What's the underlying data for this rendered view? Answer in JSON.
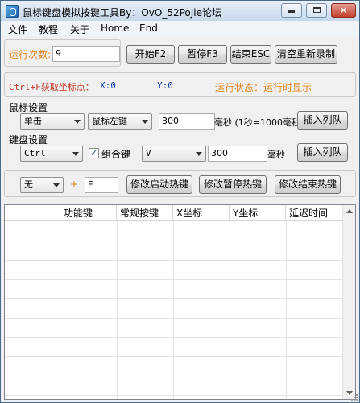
{
  "window": {
    "title": "鼠标键盘模拟按键工具By：OvO_52PoJie论坛",
    "controls": {
      "minimize": "",
      "maximize": "",
      "close": "×"
    }
  },
  "menu": {
    "items": [
      "文件",
      "教程",
      "关于",
      "Home",
      "End"
    ]
  },
  "run": {
    "count_label": "运行次数:",
    "count_value": "9",
    "start_button": "开始F2",
    "pause_button": "暂停F3",
    "end_button": "结束ESC",
    "clear_button": "清空重新录制"
  },
  "coords": {
    "hint": "Ctrl+F获取坐标点：",
    "x_label": "X:0",
    "y_label": "Y:0",
    "status": "运行状态：运行时显示"
  },
  "mouse": {
    "group_label": "鼠标设置",
    "action": "单击",
    "button": "鼠标左键",
    "delay_value": "300",
    "delay_unit": "毫秒 (1秒=1000毫秒)",
    "insert_button": "插入列队"
  },
  "keyboard": {
    "group_label": "键盘设置",
    "modifier": "Ctrl",
    "combo_checked": true,
    "combo_label": "组合键",
    "key": "V",
    "delay_value": "300",
    "delay_unit": "毫秒",
    "insert_button": "插入列队"
  },
  "hotkeys": {
    "modifier": "无",
    "plus": "+",
    "key_value": "E",
    "start_button": "修改启动热键",
    "pause_button": "修改暂停热键",
    "end_button": "修改结束热键"
  },
  "table": {
    "columns": [
      "功能键",
      "常规按键",
      "X坐标",
      "Y坐标",
      "延迟时间"
    ],
    "rows": []
  },
  "colors": {
    "status_orange": "#e08a24",
    "hint_red": "#c0392b",
    "coord_blue": "#1a3fb0"
  }
}
